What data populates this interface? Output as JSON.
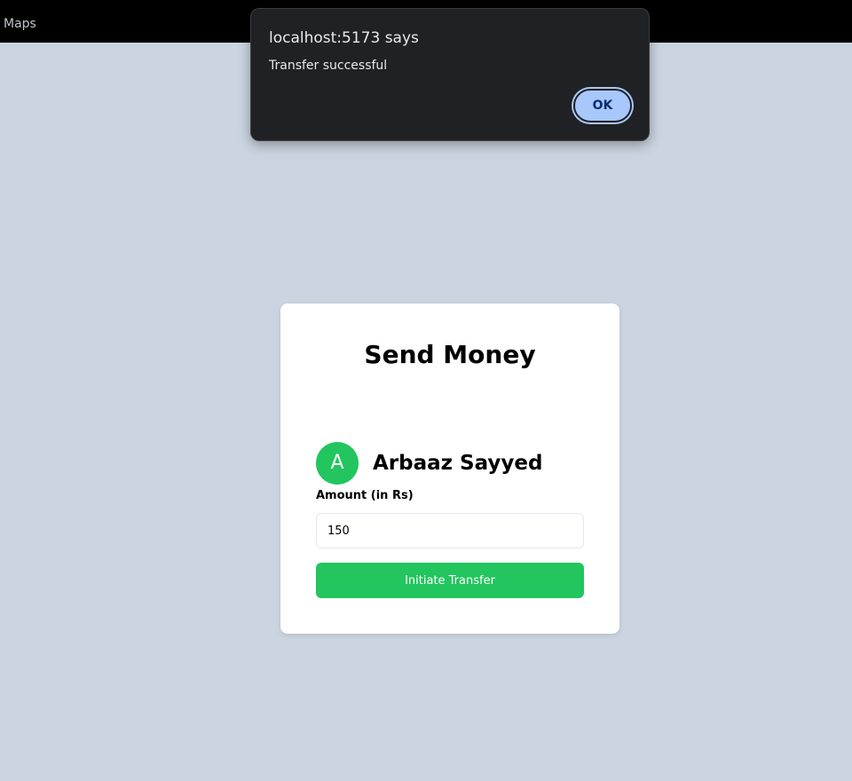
{
  "browser": {
    "bookmark_label": "Maps"
  },
  "dialog": {
    "title": "localhost:5173 says",
    "message": "Transfer successful",
    "ok_label": "OK"
  },
  "card": {
    "title": "Send Money",
    "recipient": {
      "initial": "A",
      "name": "Arbaaz Sayyed"
    },
    "amount_label": "Amount (in Rs)",
    "amount_value": "150",
    "button_label": "Initiate Transfer"
  },
  "colors": {
    "page_background": "#cbd5e1",
    "accent_green": "#22c55e",
    "dialog_background": "#202124",
    "dialog_button": "#a8c7fa"
  }
}
